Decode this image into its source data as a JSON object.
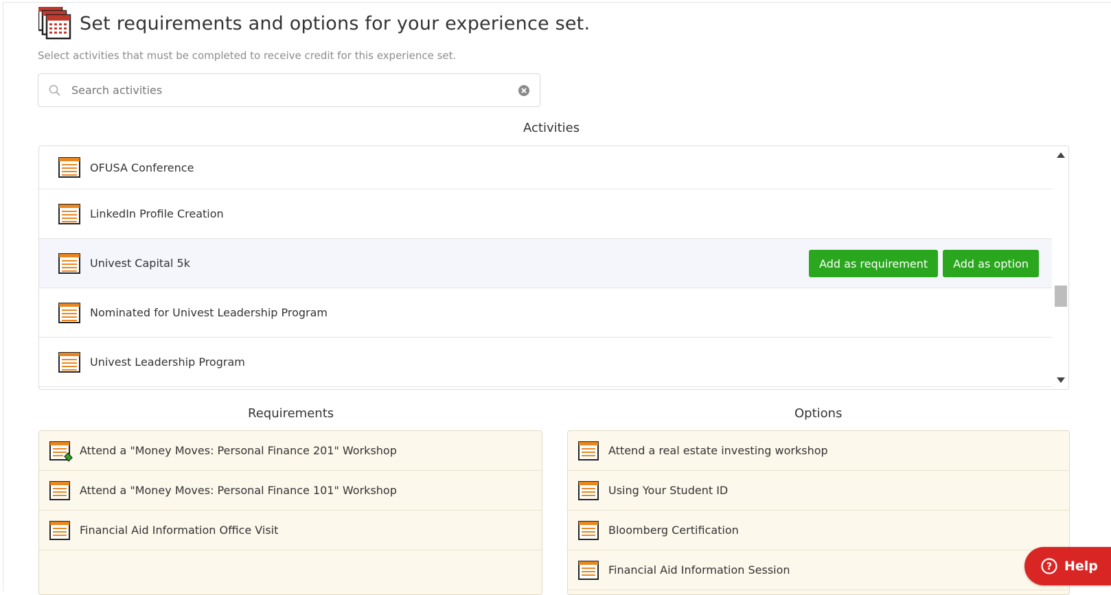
{
  "header": {
    "title": "Set requirements and options for your experience set.",
    "subtitle": "Select activities that must be completed to receive credit for this experience set."
  },
  "search": {
    "placeholder": "Search activities",
    "value": ""
  },
  "activities": {
    "title": "Activities",
    "items": [
      {
        "label": "OFUSA Conference"
      },
      {
        "label": "LinkedIn Profile Creation"
      },
      {
        "label": "Univest Capital 5k"
      },
      {
        "label": "Nominated for Univest Leadership Program"
      },
      {
        "label": "Univest Leadership Program"
      }
    ],
    "add_requirement_label": "Add as requirement",
    "add_option_label": "Add as option"
  },
  "requirements": {
    "title": "Requirements",
    "items": [
      {
        "label": "Attend a \"Money Moves: Personal Finance 201\" Workshop"
      },
      {
        "label": "Attend a \"Money Moves: Personal Finance 101\" Workshop"
      },
      {
        "label": "Financial Aid Information Office Visit"
      }
    ]
  },
  "options": {
    "title": "Options",
    "items": [
      {
        "label": "Attend a real estate investing workshop"
      },
      {
        "label": "Using Your Student ID"
      },
      {
        "label": "Bloomberg Certification"
      },
      {
        "label": "Financial Aid Information Session"
      }
    ]
  },
  "help": {
    "label": "Help"
  },
  "colors": {
    "button_green": "#2aa71e",
    "help_red": "#d92624",
    "panel_bg": "#fdf8ec",
    "icon_orange": "#e8861f"
  }
}
